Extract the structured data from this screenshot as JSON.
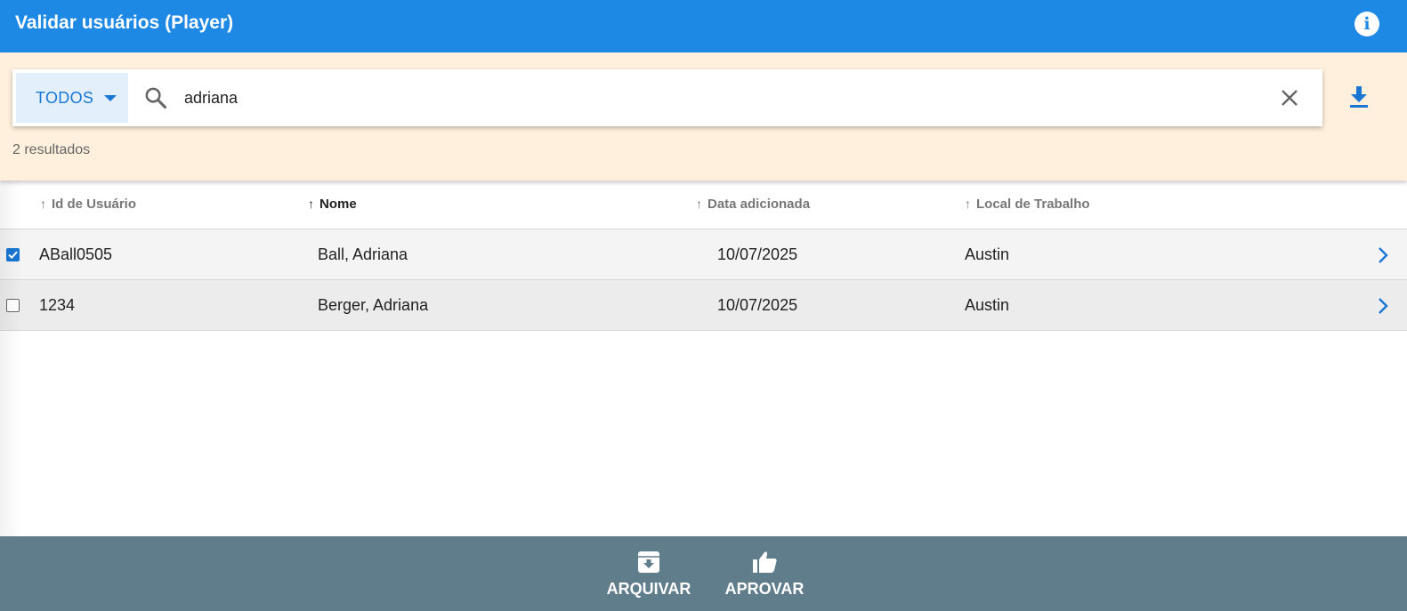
{
  "app": {
    "title": "Validar usuários (Player)",
    "accent_color": "#1e88e5",
    "info_icon_glyph": "i"
  },
  "filter": {
    "scope_label": "TODOS",
    "search_value": "adriana",
    "result_count": "2 resultados",
    "band_color": "#fff0dd"
  },
  "table": {
    "columns": [
      {
        "label": "Id de Usuário",
        "sort": "asc",
        "active": false
      },
      {
        "label": "Nome",
        "sort": "asc",
        "active": true
      },
      {
        "label": "Data adicionada",
        "sort": "asc",
        "active": false
      },
      {
        "label": "Local de Trabalho",
        "sort": "asc",
        "active": false
      }
    ],
    "rows": [
      {
        "id": "ABall0505",
        "name": "Ball, Adriana",
        "date": "10/07/2025",
        "workplace": "Austin",
        "checked": true
      },
      {
        "id": "1234",
        "name": "Berger, Adriana",
        "date": "10/07/2025",
        "workplace": "Austin",
        "checked": false
      }
    ]
  },
  "actions": {
    "archive_label": "ARQUIVAR",
    "approve_label": "APROVAR",
    "bar_color": "#607d8b"
  }
}
